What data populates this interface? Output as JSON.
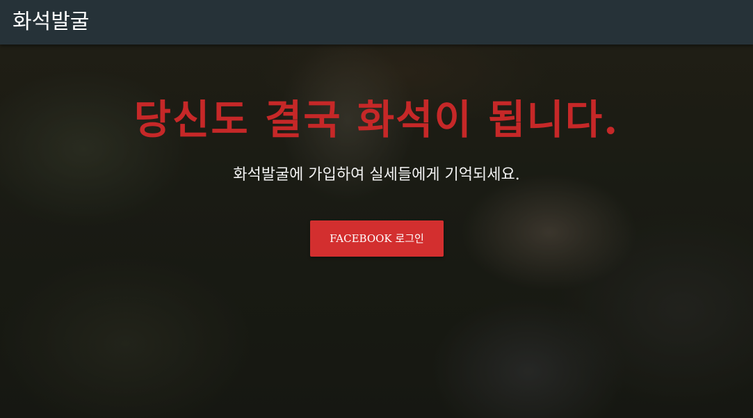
{
  "navbar": {
    "brand": "화석발굴"
  },
  "hero": {
    "headline": "당신도 결국 화석이 됩니다.",
    "subline": "화석발굴에 가입하여 실세들에게 기억되세요.",
    "login_button": "FACEBOOK 로그인"
  },
  "colors": {
    "navbar_bg": "#263238",
    "headline": "#c62828",
    "button_bg": "#d32f2f",
    "text_light": "#f2f2f2"
  }
}
